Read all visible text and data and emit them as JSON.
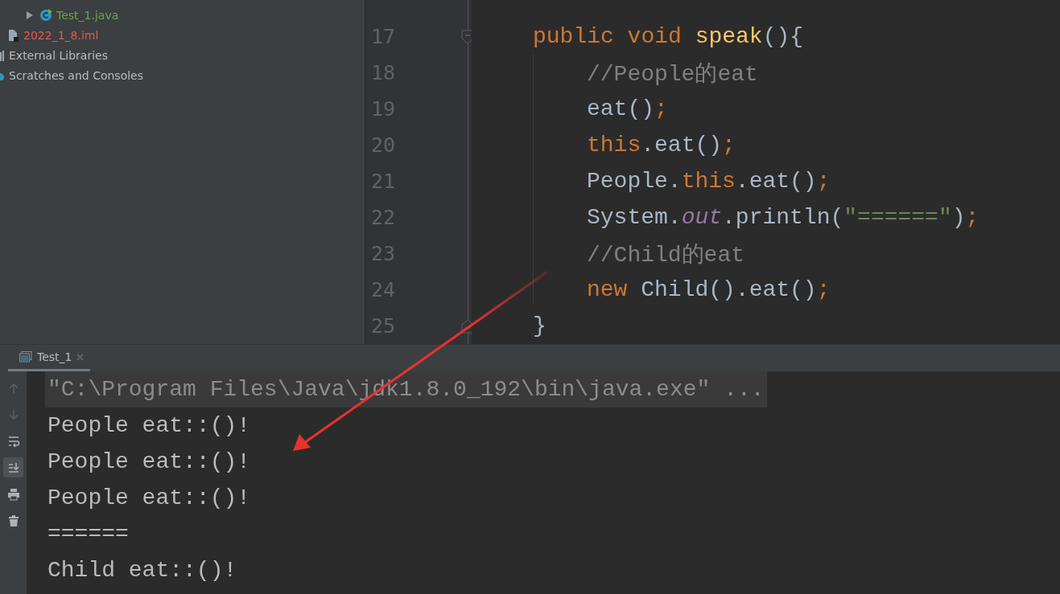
{
  "project_tree": [
    {
      "label": "Test_1.java",
      "kind": "java",
      "expanded": false
    },
    {
      "label": "2022_1_8.iml",
      "kind": "iml"
    },
    {
      "label": "External Libraries",
      "kind": "libraries"
    },
    {
      "label": "Scratches and Consoles",
      "kind": "scratches"
    }
  ],
  "editor": {
    "lines": [
      {
        "number": "17",
        "fold_start": true,
        "tokens": [
          {
            "kind": "keyword",
            "text": "public void "
          },
          {
            "kind": "function",
            "text": "speak"
          },
          {
            "kind": "plain",
            "text": "(){"
          }
        ],
        "children": [
          {
            "number": "18",
            "tokens": [
              {
                "kind": "comment",
                "text": "//People的eat"
              }
            ]
          },
          {
            "number": "19",
            "tokens": [
              {
                "kind": "plain",
                "text": "eat()"
              },
              {
                "kind": "keyword",
                "text": ";"
              }
            ]
          },
          {
            "number": "20",
            "tokens": [
              {
                "kind": "keyword",
                "text": "this"
              },
              {
                "kind": "plain",
                "text": ".eat()"
              },
              {
                "kind": "keyword",
                "text": ";"
              }
            ]
          },
          {
            "number": "21",
            "tokens": [
              {
                "kind": "plain",
                "text": "People."
              },
              {
                "kind": "keyword",
                "text": "this"
              },
              {
                "kind": "plain",
                "text": ".eat()"
              },
              {
                "kind": "keyword",
                "text": ";"
              }
            ]
          },
          {
            "number": "22",
            "tokens": [
              {
                "kind": "plain",
                "text": "System."
              },
              {
                "kind": "field",
                "text": "out"
              },
              {
                "kind": "plain",
                "text": ".println("
              },
              {
                "kind": "string",
                "text": "\"======\""
              },
              {
                "kind": "plain",
                "text": ")"
              },
              {
                "kind": "keyword",
                "text": ";"
              }
            ]
          },
          {
            "number": "23",
            "tokens": [
              {
                "kind": "comment",
                "text": "//Child的eat"
              }
            ]
          },
          {
            "number": "24",
            "tokens": [
              {
                "kind": "keyword",
                "text": "new "
              },
              {
                "kind": "plain",
                "text": "Child().eat()"
              },
              {
                "kind": "keyword",
                "text": ";"
              }
            ]
          }
        ]
      },
      {
        "number": "25",
        "fold_end": true,
        "tokens": [
          {
            "kind": "punct",
            "text": "}"
          }
        ]
      }
    ]
  },
  "run_panel": {
    "tab": {
      "label": "Test_1",
      "selected": true
    },
    "toolbar": [
      {
        "kind": "up",
        "disabled": true
      },
      {
        "kind": "down",
        "disabled": true
      },
      {
        "kind": "wrap",
        "on": false
      },
      {
        "kind": "scroll",
        "on": true
      },
      {
        "kind": "print",
        "on": false
      },
      {
        "kind": "trash",
        "on": false
      }
    ],
    "output": [
      {
        "kind": "command",
        "text": "\"C:\\Program Files\\Java\\jdk1.8.0_192\\bin\\java.exe\" ..."
      },
      {
        "kind": "stdout",
        "text": "People eat::()!"
      },
      {
        "kind": "stdout",
        "text": "People eat::()!"
      },
      {
        "kind": "stdout",
        "text": "People eat::()!"
      },
      {
        "kind": "stdout",
        "text": "======"
      },
      {
        "kind": "stdout",
        "text": "Child eat::()!"
      }
    ]
  }
}
